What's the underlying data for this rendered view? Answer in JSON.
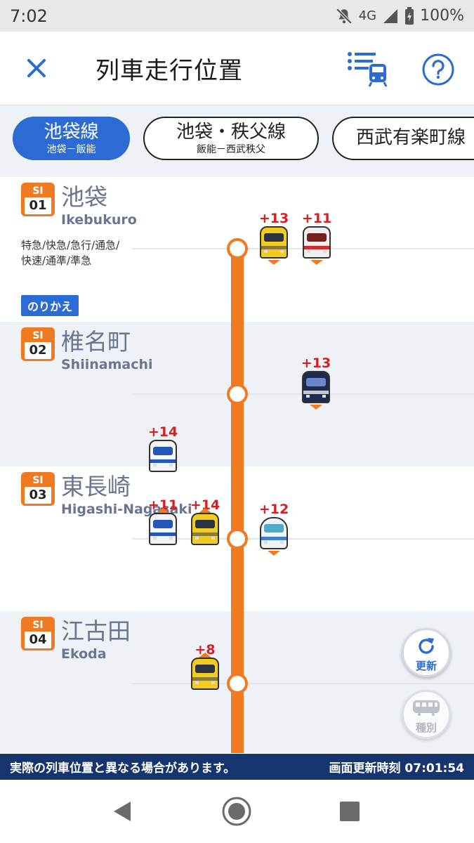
{
  "status_bar": {
    "time": "7:02",
    "network": "4G",
    "battery": "100%"
  },
  "header": {
    "title": "列車走行位置",
    "close_icon": "close-icon",
    "list_icon": "train-list-icon",
    "help_icon": "help-icon"
  },
  "tabs": [
    {
      "name": "池袋線",
      "sub": "池袋－飯能",
      "active": true
    },
    {
      "name": "池袋・秩父線",
      "sub": "飯能－西武秩父",
      "active": false
    },
    {
      "name": "西武有楽町線",
      "sub": "",
      "active": false
    }
  ],
  "stations": [
    {
      "code": "SI",
      "num": "01",
      "name_ja": "池袋",
      "name_en": "Ikebukuro",
      "types": "特急/快急/急行/通急/快速/通準/準急",
      "transfer": "のりかえ"
    },
    {
      "code": "SI",
      "num": "02",
      "name_ja": "椎名町",
      "name_en": "Shiinamachi"
    },
    {
      "code": "SI",
      "num": "03",
      "name_ja": "東長崎",
      "name_en": "Higashi-Nagasaki"
    },
    {
      "code": "SI",
      "num": "04",
      "name_ja": "江古田",
      "name_en": "Ekoda"
    }
  ],
  "trains": [
    {
      "delay": "+13",
      "color": "yellow",
      "direction": "down"
    },
    {
      "delay": "+11",
      "color": "red",
      "direction": "down"
    },
    {
      "delay": "+13",
      "color": "navy",
      "direction": "down"
    },
    {
      "delay": "+14",
      "color": "blue",
      "direction": "none"
    },
    {
      "delay": "+11",
      "color": "blue",
      "direction": "up"
    },
    {
      "delay": "+14",
      "color": "yellow",
      "direction": "up"
    },
    {
      "delay": "+12",
      "color": "white",
      "direction": "down"
    },
    {
      "delay": "+8",
      "color": "yellow",
      "direction": "up"
    }
  ],
  "buttons": {
    "refresh": "更新",
    "type": "種別"
  },
  "notice": {
    "message": "実際の列車位置と異なる場合があります。",
    "timestamp": "画面更新時刻 07:01:54"
  },
  "colors": {
    "accent": "#2c6bd3",
    "line_orange": "#f07a22",
    "delay_red": "#d81e1e",
    "notice_bg": "#16346e"
  }
}
